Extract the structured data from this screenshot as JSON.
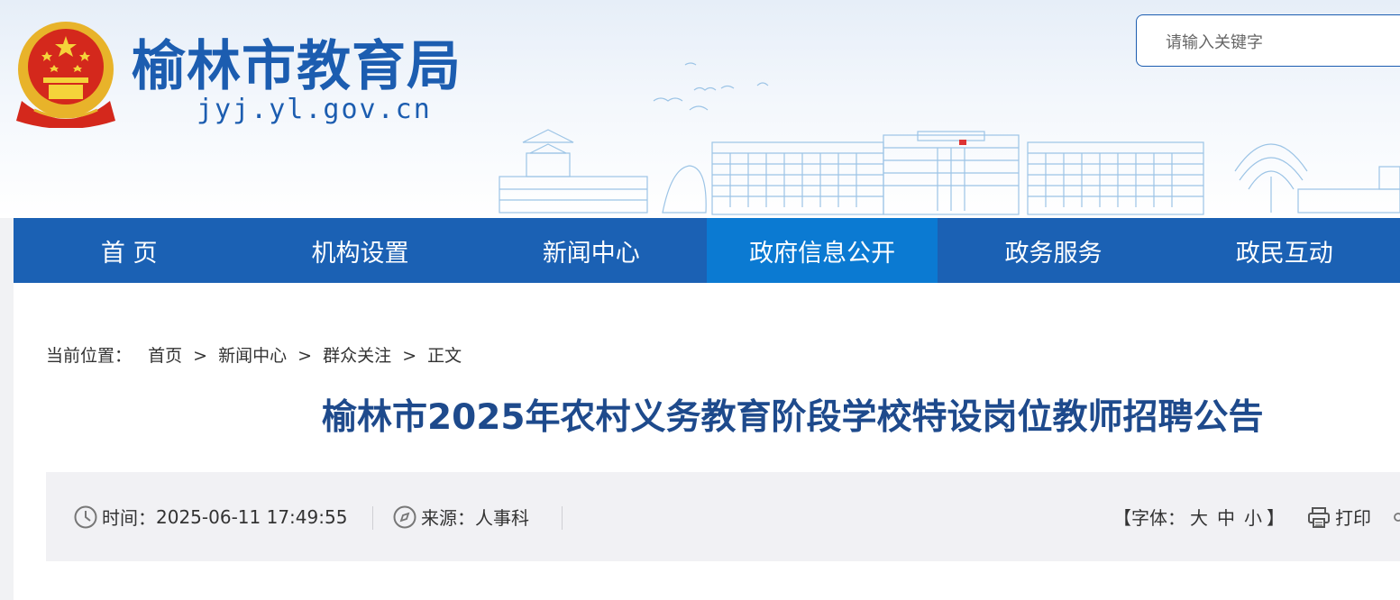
{
  "header": {
    "site_title": "榆林市教育局",
    "site_domain": "jyj.yl.gov.cn",
    "emblem_icon": "national-emblem-icon",
    "search_placeholder": "请输入关键字"
  },
  "nav": {
    "items": [
      {
        "label": "首 页"
      },
      {
        "label": "机构设置"
      },
      {
        "label": "新闻中心"
      },
      {
        "label": "政府信息公开"
      },
      {
        "label": "政务服务"
      },
      {
        "label": "政民互动"
      }
    ],
    "active_index": 3
  },
  "breadcrumb": {
    "label": "当前位置：",
    "separator": ">",
    "items": [
      "首页",
      "新闻中心",
      "群众关注",
      "正文"
    ]
  },
  "article": {
    "title": "榆林市2025年农村义务教育阶段学校特设岗位教师招聘公告",
    "time_label": "时间：",
    "time_value": "2025-06-11 17:49:55",
    "source_label": "来源：",
    "source_value": "人事科",
    "font_open": "【字体：",
    "font_large": "大",
    "font_medium": "中",
    "font_small": "小",
    "font_close": "】",
    "print_label": "打印"
  },
  "colors": {
    "brand_blue": "#1c5db0",
    "nav_bg": "#1b61b4",
    "nav_active": "#0b7ad2",
    "title_color": "#1e4a8c"
  }
}
